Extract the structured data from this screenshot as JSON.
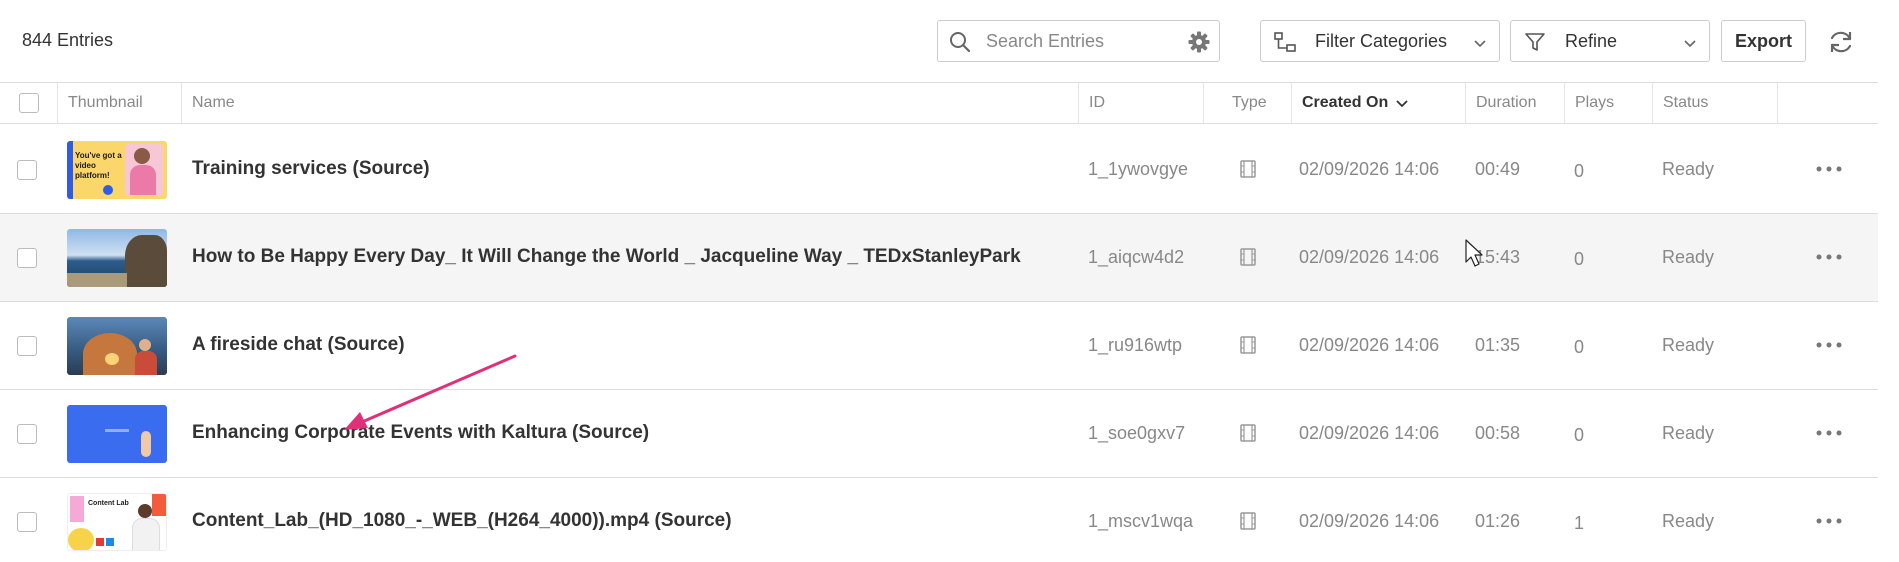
{
  "header": {
    "entries_count": "844 Entries",
    "search": {
      "placeholder": "Search Entries",
      "value": ""
    },
    "filter_categories_label": "Filter Categories",
    "refine_label": "Refine",
    "export_label": "Export"
  },
  "table": {
    "columns": {
      "thumbnail": "Thumbnail",
      "name": "Name",
      "id": "ID",
      "type": "Type",
      "created_on": "Created On",
      "duration": "Duration",
      "plays": "Plays",
      "status": "Status"
    },
    "sorted_by": "Created On",
    "rows": [
      {
        "name": "Training services (Source)",
        "id": "1_1ywovgye",
        "type_icon": "video-icon",
        "created": "02/09/2026 14:06",
        "duration": "00:49",
        "plays": "0",
        "status": "Ready",
        "thumbnail_text": "You've got a video platform!"
      },
      {
        "name": "How to Be Happy Every Day_ It Will Change the World _ Jacqueline Way _ TEDxStanleyPark",
        "id": "1_aiqcw4d2",
        "type_icon": "video-icon",
        "created": "02/09/2026 14:06",
        "duration": "15:43",
        "plays": "0",
        "status": "Ready"
      },
      {
        "name": "A fireside chat (Source)",
        "id": "1_ru916wtp",
        "type_icon": "video-icon",
        "created": "02/09/2026 14:06",
        "duration": "01:35",
        "plays": "0",
        "status": "Ready"
      },
      {
        "name": "Enhancing Corporate Events with Kaltura (Source)",
        "id": "1_soe0gxv7",
        "type_icon": "video-icon",
        "created": "02/09/2026 14:06",
        "duration": "00:58",
        "plays": "0",
        "status": "Ready"
      },
      {
        "name": "Content_Lab_(HD_1080_-_WEB_(H264_4000)).mp4 (Source)",
        "id": "1_mscv1wqa",
        "type_icon": "video-icon",
        "created": "02/09/2026 14:06",
        "duration": "01:26",
        "plays": "1",
        "status": "Ready",
        "thumbnail_text": "Content Lab"
      }
    ]
  },
  "annotation": {
    "arrow_color": "#e0307a"
  },
  "colors": {
    "text_primary": "#333333",
    "text_muted": "#888888",
    "border": "#dddddd",
    "row_hover": "#f5f5f5"
  }
}
